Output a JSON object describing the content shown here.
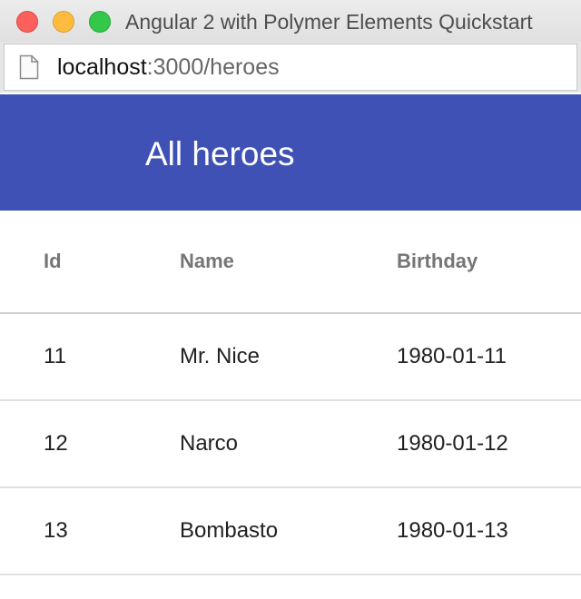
{
  "window": {
    "title": "Angular 2 with Polymer Elements Quickstart",
    "colors": {
      "close": "#fc605c",
      "minimize": "#fdbc40",
      "maximize": "#34c84a"
    }
  },
  "addressbar": {
    "icon": "page-icon",
    "host": "localhost",
    "path": ":3000/heroes"
  },
  "header": {
    "title": "All heroes",
    "background": "#3f51b5"
  },
  "table": {
    "columns": [
      "Id",
      "Name",
      "Birthday"
    ],
    "rows": [
      {
        "id": "11",
        "name": "Mr. Nice",
        "birthday": "1980-01-11"
      },
      {
        "id": "12",
        "name": "Narco",
        "birthday": "1980-01-12"
      },
      {
        "id": "13",
        "name": "Bombasto",
        "birthday": "1980-01-13"
      }
    ]
  }
}
